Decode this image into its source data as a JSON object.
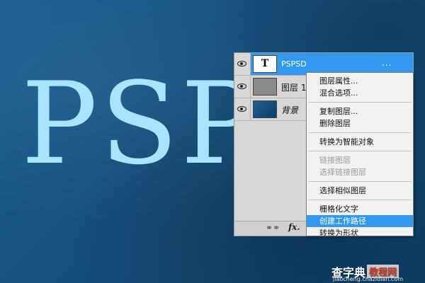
{
  "canvas": {
    "text": "PSP"
  },
  "layers": [
    {
      "name": "PSPSD",
      "thumb_glyph": "T",
      "dots": "...",
      "selected": true
    },
    {
      "name": "图层 1"
    },
    {
      "name": "背景"
    }
  ],
  "menu": {
    "groups": [
      [
        "图层属性...",
        "混合选项..."
      ],
      [
        "复制图层...",
        "删除图层"
      ],
      [
        "转换为智能对象"
      ],
      [
        "链接图层",
        "选择链接图层"
      ],
      [
        "选择相似图层"
      ],
      [
        "栅格化文字",
        "创建工作路径",
        "转换为形状"
      ]
    ],
    "disabled": [
      "链接图层",
      "选择链接图层"
    ],
    "highlighted": "创建工作路径"
  },
  "watermark": {
    "brand": "查字典",
    "box": "教程网",
    "url": "jiaocheng.chazidian.com"
  },
  "colors": {
    "canvas_bg": "#15507f",
    "canvas_text": "#a8e4ff",
    "selection": "#3399ee"
  }
}
